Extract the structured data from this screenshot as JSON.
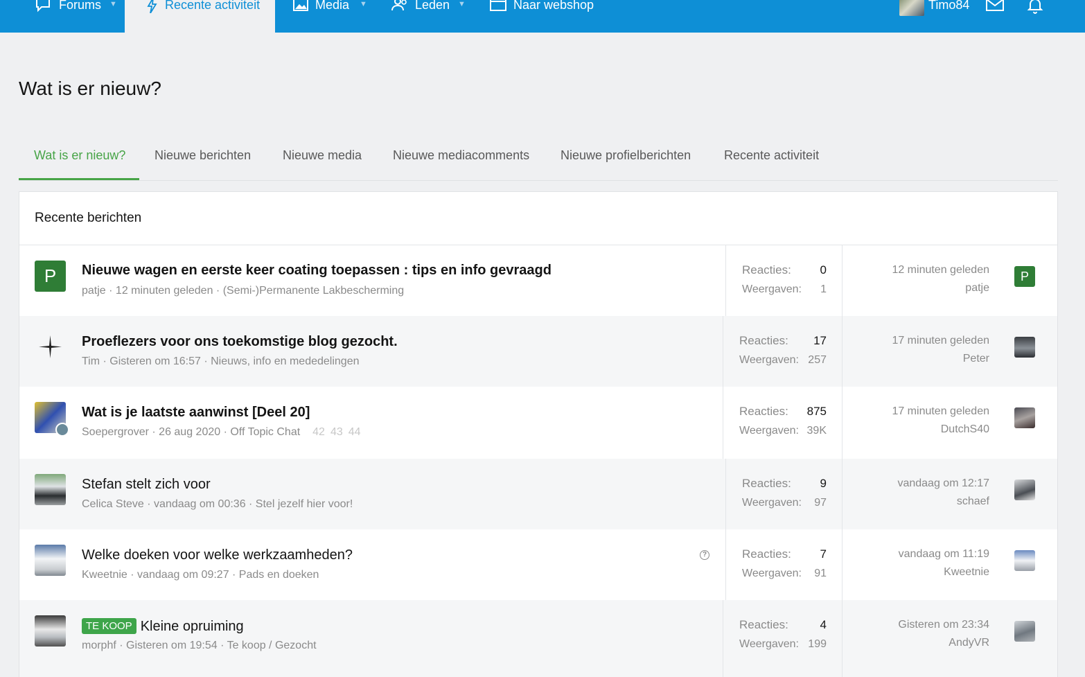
{
  "nav": {
    "forums": "Forums",
    "recent": "Recente activiteit",
    "media": "Media",
    "members": "Leden",
    "shop": "Naar webshop",
    "username": "Timo84"
  },
  "page_title": "Wat is er nieuw?",
  "tabs": [
    {
      "label": "Wat is er nieuw?"
    },
    {
      "label": "Nieuwe berichten"
    },
    {
      "label": "Nieuwe media"
    },
    {
      "label": "Nieuwe mediacomments"
    },
    {
      "label": "Nieuwe profielberichten"
    },
    {
      "label": "Recente activiteit"
    }
  ],
  "block_title": "Recente berichten",
  "stat_labels": {
    "replies": "Reacties:",
    "views": "Weergaven:"
  },
  "threads": [
    {
      "title": "Nieuwe wagen en eerste keer coating toepassen : tips en info gevraagd",
      "meta": "patje · 12 minuten geleden · (Semi-)Permanente Lakbescherming",
      "replies": "0",
      "views": "1",
      "last_time": "12 minuten geleden",
      "last_user": "patje",
      "avatar_letter": "P"
    },
    {
      "title": "Proeflezers voor ons toekomstige blog gezocht.",
      "meta": "Tim · Gisteren om 16:57 · Nieuws, info en mededelingen",
      "replies": "17",
      "views": "257",
      "last_time": "17 minuten geleden",
      "last_user": "Peter"
    },
    {
      "title": "Wat is je laatste aanwinst [Deel 20]",
      "meta": "Soepergrover · 26 aug 2020 · Off Topic Chat",
      "pages": [
        "42",
        "43",
        "44"
      ],
      "replies": "875",
      "views": "39K",
      "last_time": "17 minuten geleden",
      "last_user": "DutchS40"
    },
    {
      "title": "Stefan stelt zich voor",
      "meta": "Celica Steve · vandaag om 00:36 · Stel jezelf hier voor!",
      "replies": "9",
      "views": "97",
      "last_time": "vandaag om 12:17",
      "last_user": "schaef"
    },
    {
      "title": "Welke doeken voor welke werkzaamheden?",
      "meta": "Kweetnie · vandaag om 09:27 · Pads en doeken",
      "replies": "7",
      "views": "91",
      "last_time": "vandaag om 11:19",
      "last_user": "Kweetnie"
    },
    {
      "title": "Kleine opruiming",
      "prefix": "TE KOOP",
      "meta": "morphf · Gisteren om 19:54 · Te koop / Gezocht",
      "replies": "4",
      "views": "199",
      "last_time": "Gisteren om 23:34",
      "last_user": "AndyVR"
    }
  ],
  "colors": {
    "nav_bg": "#0e8fd6",
    "active_tab": "#47a447",
    "badge": "#3ea54a"
  }
}
